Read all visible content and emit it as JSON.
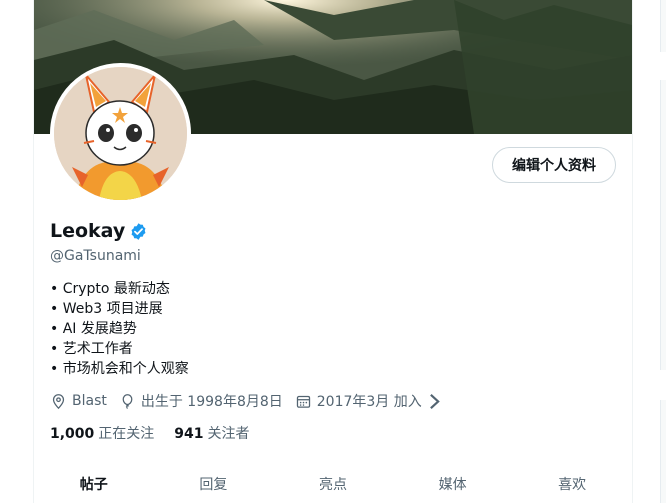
{
  "profile": {
    "display_name": "Leokay",
    "handle": "@GaTsunami",
    "edit_button": "编辑个人资料",
    "bio": [
      "• Crypto 最新动态",
      "• Web3 项目进展",
      "• AI 发展趋势",
      "• 艺术工作者",
      "• 市场机会和个人观察"
    ],
    "meta": {
      "location": "Blast",
      "birthday": "出生于 1998年8月8日",
      "joined": "2017年3月 加入"
    },
    "following": {
      "count": "1,000",
      "label": "正在关注"
    },
    "followers": {
      "count": "941",
      "label": "关注者"
    }
  },
  "tabs": [
    {
      "label": "帖子",
      "active": true
    },
    {
      "label": "回复",
      "active": false
    },
    {
      "label": "亮点",
      "active": false
    },
    {
      "label": "媒体",
      "active": false
    },
    {
      "label": "喜欢",
      "active": false
    }
  ],
  "colors": {
    "text_primary": "#0f1419",
    "text_secondary": "#536471",
    "verified_blue": "#1d9bf0",
    "border": "#cfd9de"
  },
  "icons": {
    "verified": "verified-badge-icon",
    "location": "location-pin-icon",
    "birthday": "balloon-icon",
    "joined": "calendar-icon",
    "chevron": "chevron-right-icon"
  }
}
